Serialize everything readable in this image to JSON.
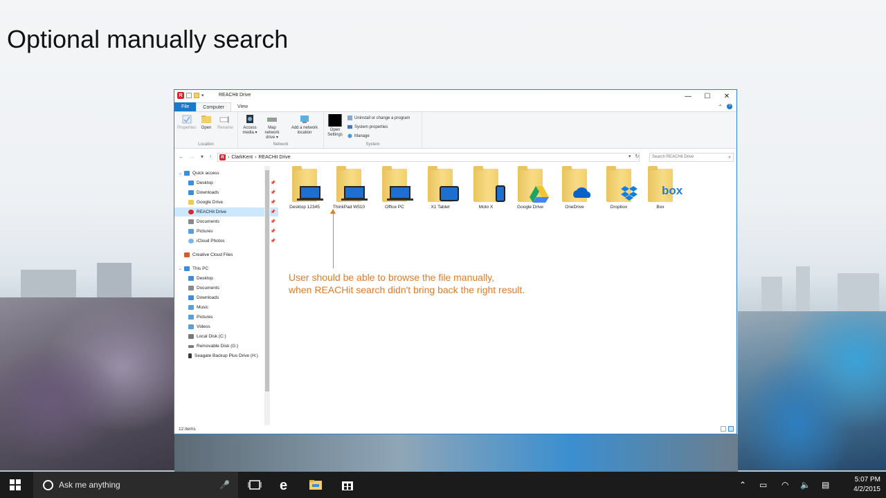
{
  "slide": {
    "title": "Optional manually search"
  },
  "window": {
    "title": "REACHit Drive",
    "app_logo_letter": "R",
    "controls": {
      "minimize": "—",
      "maximize": "☐",
      "close": "✕"
    }
  },
  "tabs": [
    {
      "label": "File"
    },
    {
      "label": "Computer"
    },
    {
      "label": "View"
    }
  ],
  "ribbon": {
    "location": {
      "label": "Location",
      "buttons": [
        {
          "label": "Properties"
        },
        {
          "label": "Open"
        },
        {
          "label": "Rename"
        }
      ]
    },
    "network": {
      "label": "Network",
      "buttons": [
        {
          "label": "Access media ▾"
        },
        {
          "label": "Map network drive ▾"
        },
        {
          "label": "Add a network location"
        }
      ]
    },
    "system": {
      "label": "System",
      "open_settings": "Open Settings",
      "items": [
        {
          "label": "Uninstall or change a program"
        },
        {
          "label": "System properties"
        },
        {
          "label": "Manage"
        }
      ]
    }
  },
  "address": {
    "crumbs": [
      "ClarkKent",
      "REACHit Drive"
    ],
    "separator": "›",
    "search_placeholder": "Search REACHit Drive"
  },
  "nav": {
    "items": [
      {
        "label": "Quick access",
        "color": "#3c8ddc"
      },
      {
        "label": "Desktop",
        "color": "#3c8ddc"
      },
      {
        "label": "Downloads",
        "color": "#3c8ddc"
      },
      {
        "label": "Google Drive",
        "color": "#f2c94c"
      },
      {
        "label": "REACHit Drive",
        "color": "#d9262c"
      },
      {
        "label": "Documents",
        "color": "#8a8a8a"
      },
      {
        "label": "Pictures",
        "color": "#5aa0d8"
      },
      {
        "label": "iCloud Photos",
        "color": "#7ab8e8"
      },
      {
        "label": "Creative Cloud Files",
        "color": "#d95a2b"
      },
      {
        "label": "This PC",
        "color": "#3c8ddc"
      },
      {
        "label": "Desktop",
        "color": "#3c8ddc"
      },
      {
        "label": "Documents",
        "color": "#8a8a8a"
      },
      {
        "label": "Downloads",
        "color": "#3c8ddc"
      },
      {
        "label": "Music",
        "color": "#5aa0d8"
      },
      {
        "label": "Pictures",
        "color": "#5aa0d8"
      },
      {
        "label": "Videos",
        "color": "#5aa0d8"
      },
      {
        "label": "Local Disk (C:)",
        "color": "#7a7a7a"
      },
      {
        "label": "Removable Disk (G:)",
        "color": "#7a7a7a"
      },
      {
        "label": "Seagate Backup Plus Drive (H:)",
        "color": "#3a3a3a"
      }
    ]
  },
  "folders": [
    {
      "label": "Desktop 12345",
      "overlay": "laptop"
    },
    {
      "label": "ThinkPad W510",
      "overlay": "laptop"
    },
    {
      "label": "Office PC",
      "overlay": "laptop"
    },
    {
      "label": "X1 Tablet",
      "overlay": "tablet"
    },
    {
      "label": "Moto X",
      "overlay": "phone"
    },
    {
      "label": "Google Drive",
      "overlay": "google-drive"
    },
    {
      "label": "OneDrive",
      "overlay": "onedrive"
    },
    {
      "label": "Dropbox",
      "overlay": "dropbox"
    },
    {
      "label": "Box",
      "overlay": "box"
    }
  ],
  "box_logo_text": "box",
  "annotation": {
    "line1": "User should be able to browse the file manually,",
    "line2": "when REACHit search didn't bring back the right result."
  },
  "status": {
    "items": "12 items"
  },
  "taskbar": {
    "search_text": "Ask me anything",
    "time": "5:07 PM",
    "date": "4/2/2015"
  },
  "colors": {
    "accent": "#1979ca",
    "annotation": "#e07b2a",
    "folder": "#f2cf6b"
  }
}
